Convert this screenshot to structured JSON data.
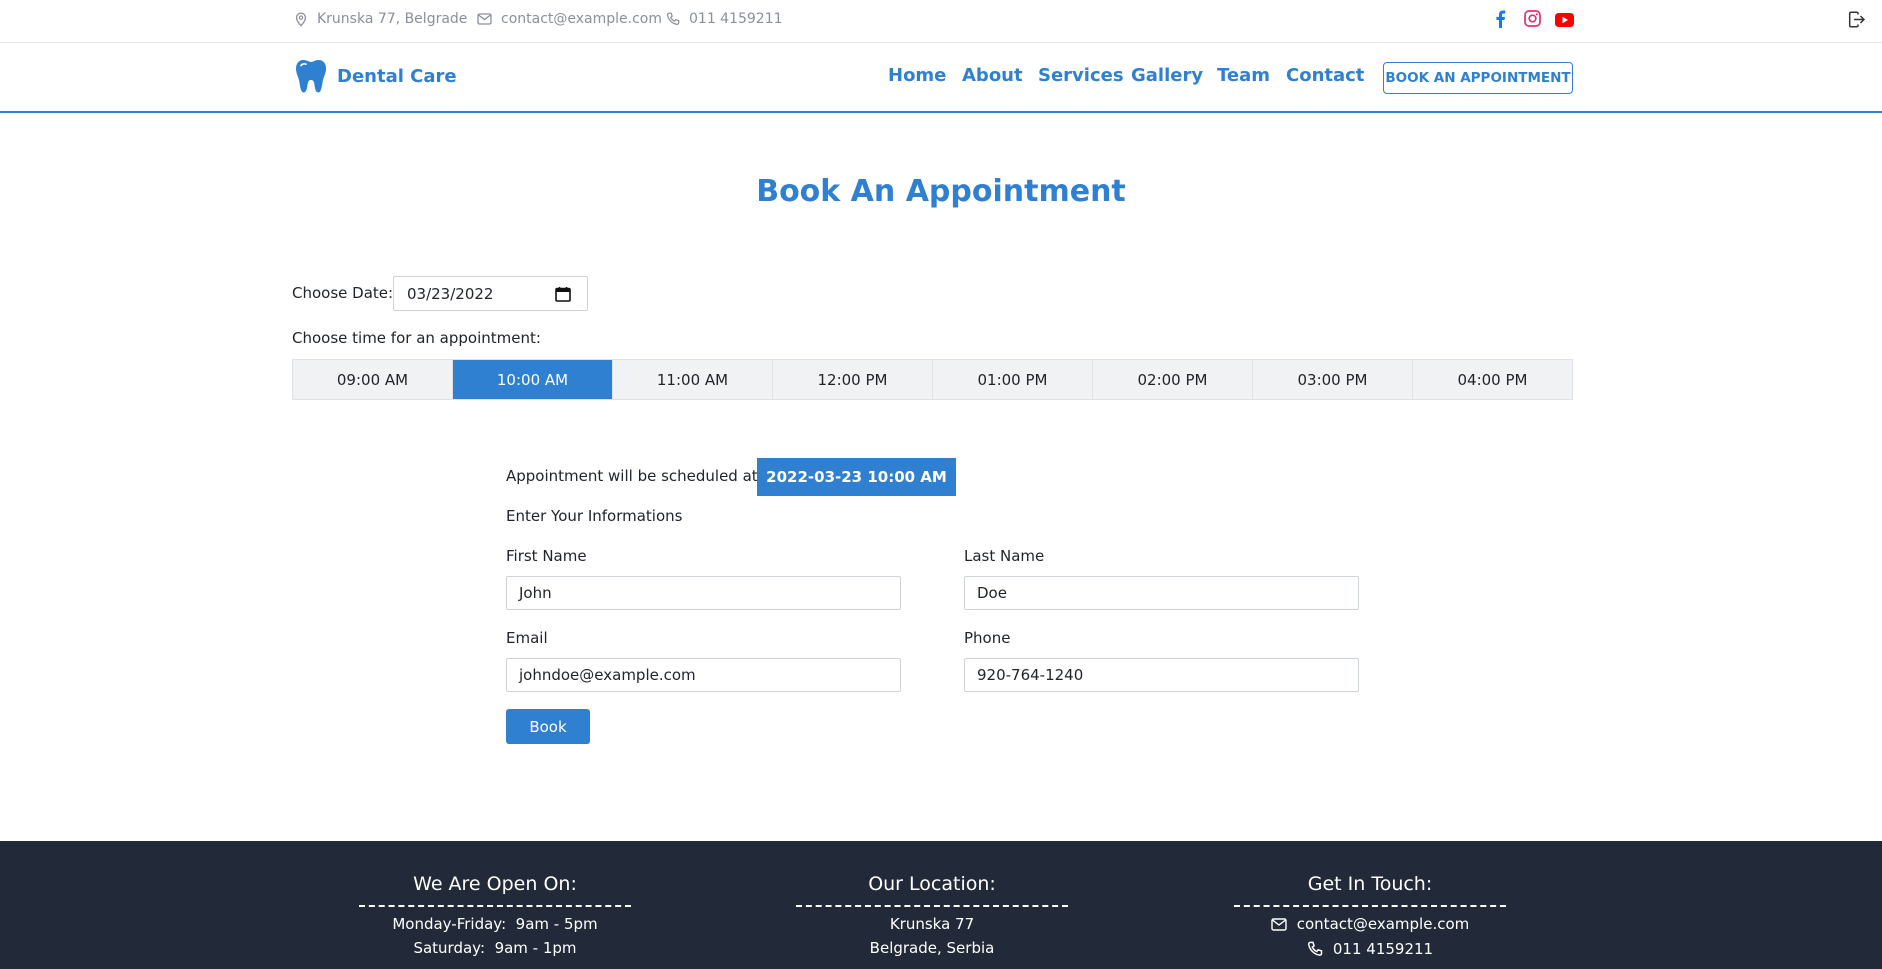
{
  "topbar": {
    "address": "Krunska 77, Belgrade",
    "email": "contact@example.com",
    "phone": "011 4159211",
    "social_icons": [
      "facebook-icon",
      "instagram-icon",
      "youtube-icon"
    ],
    "social_colors": {
      "facebook": "#1877f2",
      "instagram": "#e1306c",
      "youtube": "#ff0000"
    }
  },
  "nav": {
    "brand": "Dental Care",
    "links": [
      "Home",
      "About",
      "Services",
      "Gallery",
      "Team",
      "Contact"
    ],
    "cta": "BOOK AN APPOINTMENT",
    "accent": "#2f80d1"
  },
  "main": {
    "title": "Book An Appointment",
    "date_label": "Choose Date:",
    "date_value": "03/23/2022",
    "time_label": "Choose time for an appointment:",
    "slots": [
      "09:00 AM",
      "10:00 AM",
      "11:00 AM",
      "12:00 PM",
      "01:00 PM",
      "02:00 PM",
      "03:00 PM",
      "04:00 PM"
    ],
    "selected_slot": "10:00 AM",
    "scheduled_label": "Appointment will be scheduled at:",
    "scheduled_value": "2022-03-23 10:00 AM",
    "info_heading": "Enter Your Informations",
    "form": {
      "first_name_label": "First Name",
      "first_name_value": "John",
      "last_name_label": "Last Name",
      "last_name_value": "Doe",
      "email_label": "Email",
      "email_value": "johndoe@example.com",
      "phone_label": "Phone",
      "phone_value": "920-764-1240",
      "submit": "Book"
    }
  },
  "footer": {
    "hours_title": "We Are Open On:",
    "hours": [
      {
        "days": "Monday-Friday:",
        "time": "9am - 5pm"
      },
      {
        "days": "Saturday:",
        "time": "9am - 1pm"
      }
    ],
    "location_title": "Our Location:",
    "location_lines": [
      "Krunska 77",
      "Belgrade, Serbia"
    ],
    "contact_title": "Get In Touch:",
    "contact_email": "contact@example.com",
    "contact_phone": "011 4159211",
    "background": "#222938"
  }
}
